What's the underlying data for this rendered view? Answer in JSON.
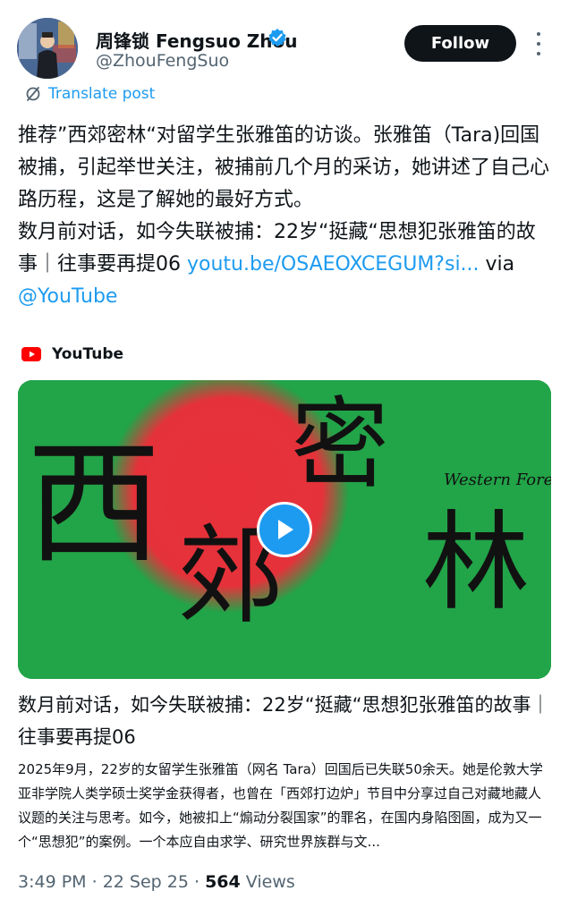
{
  "author": {
    "name": "周锋锁 Fengsuo Zhou",
    "handle": "@ZhouFengSuo",
    "verified": true
  },
  "header": {
    "follow_label": "Follow"
  },
  "translate": {
    "label": "Translate post"
  },
  "post": {
    "paragraph1": "推荐”西郊密林“对留学生张雅笛的访谈。张雅笛（Tara)回国被捕，引起举世关注，被捕前几个月的采访，她讲述了自己心路历程，这是了解她的最好方式。",
    "paragraph2_text": "数月前对话，如今失联被捕：22岁“挺藏“思想犯张雅笛的故事｜往事要再提06 ",
    "link_text": "youtu.be/OSAEOXCEGUM?si...",
    "via_text": " via",
    "mention": "@YouTube"
  },
  "card": {
    "source": "YouTube",
    "thumbnail_text": {
      "glyph1": "西",
      "glyph2": "郊",
      "glyph3": "密",
      "glyph4": "林",
      "subtitle": "Western Fores"
    },
    "title": "数月前对话，如今失联被捕：22岁“挺藏“思想犯张雅笛的故事｜往事要再提06",
    "description": "2025年9月，22岁的女留学生张雅笛（网名 Tara）回国后已失联50余天。她是伦敦大学亚非学院人类学硕士奖学金获得者，也曾在「西郊打边炉」节目中分享过自己对藏地藏人议题的关注与思考。如今，她被扣上“煽动分裂国家”的罪名，在国内身陷囹圄，成为又一个“思想犯”的案例。一个本应自由求学、研究世界族群与文..."
  },
  "meta": {
    "time": "3:49 PM",
    "sep1": " · ",
    "date": "22 Sep 25",
    "sep2": " · ",
    "views_count": "564",
    "views_label": " Views"
  },
  "colors": {
    "accent": "#1d9bf0",
    "text": "#0f1419",
    "secondary": "#536471",
    "thumbnail_green": "#22a448",
    "thumbnail_red": "#e8303a",
    "youtube_red": "#ff0000"
  }
}
